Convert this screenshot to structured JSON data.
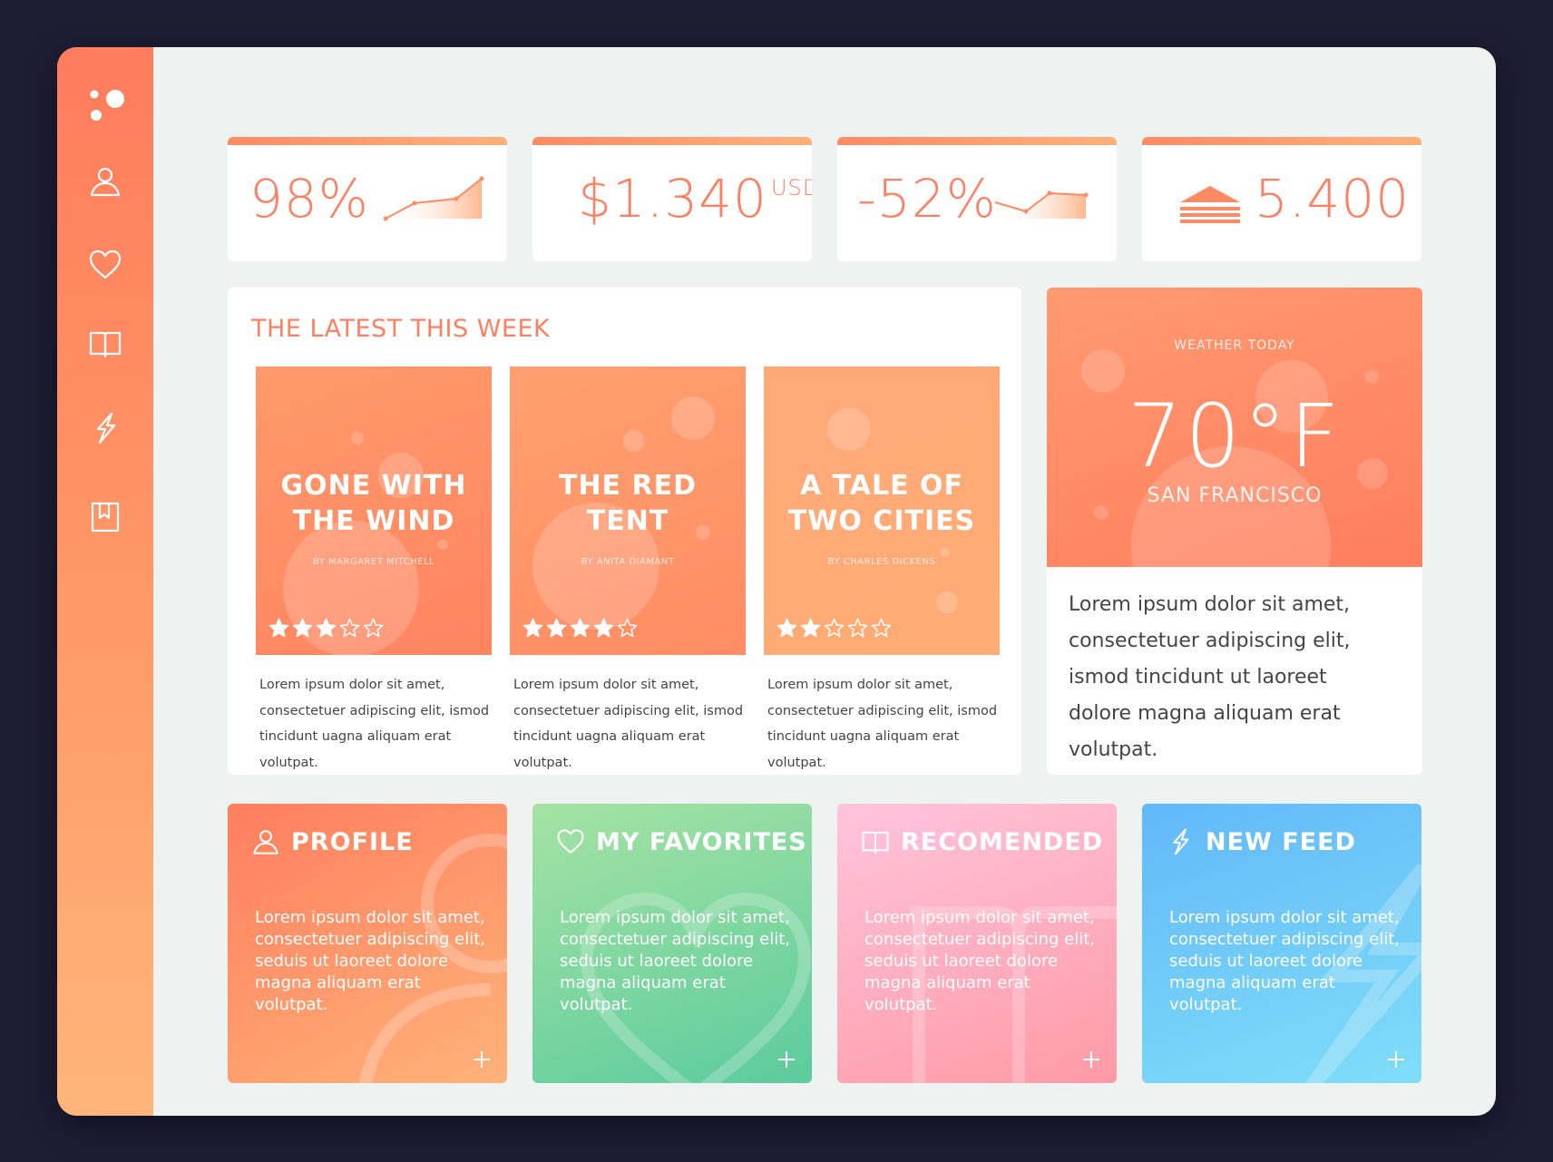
{
  "stats": [
    {
      "value": "98%",
      "unit": ""
    },
    {
      "value": "$1.340",
      "unit": "USD"
    },
    {
      "value": "-52%",
      "unit": ""
    },
    {
      "value": "5.400",
      "unit": ""
    }
  ],
  "latest": {
    "title": "THE LATEST THIS WEEK",
    "books": [
      {
        "title_line1": "GONE WITH",
        "title_line2": "THE WIND",
        "author": "BY MARGARET MITCHELL",
        "rating": 3,
        "rating_max": 5,
        "desc": "Lorem ipsum dolor sit amet, consectetuer adipiscing elit, ismod tincidunt uagna aliquam erat volutpat."
      },
      {
        "title_line1": "THE RED",
        "title_line2": "TENT",
        "author": "BY ANITA DIAMANT",
        "rating": 4,
        "rating_max": 5,
        "desc": "Lorem ipsum dolor sit amet, consectetuer adipiscing elit, ismod tincidunt uagna aliquam erat volutpat."
      },
      {
        "title_line1": "A TALE OF",
        "title_line2": "TWO CITIES",
        "author": "BY CHARLES DICKENS",
        "rating": 2,
        "rating_max": 5,
        "desc": "Lorem ipsum dolor sit amet, consectetuer adipiscing elit, ismod tincidunt uagna aliquam erat volutpat."
      }
    ]
  },
  "weather": {
    "label": "WEATHER TODAY",
    "temp": "70°F",
    "city": "SAN FRANCISCO",
    "desc": "Lorem ipsum dolor sit amet, consectetuer adipiscing elit, ismod tincidunt ut laoreet dolore magna aliquam erat volutpat."
  },
  "tiles": [
    {
      "title": "PROFILE",
      "icon": "user-icon",
      "text": "Lorem ipsum dolor sit amet, consectetuer adipiscing elit, seduis ut laoreet dolore magna aliquam erat volutpat."
    },
    {
      "title": "MY FAVORITES",
      "icon": "heart-icon",
      "text": "Lorem ipsum dolor sit amet, consectetuer adipiscing elit, seduis ut laoreet dolore magna aliquam erat volutpat."
    },
    {
      "title": "RECOMENDED",
      "icon": "book-icon",
      "text": "Lorem ipsum dolor sit amet, consectetuer adipiscing elit, seduis ut laoreet dolore magna aliquam erat volutpat."
    },
    {
      "title": "NEW FEED",
      "icon": "lightning-icon",
      "text": "Lorem ipsum dolor sit amet, consectetuer adipiscing elit, seduis ut laoreet dolore magna aliquam erat volutpat."
    }
  ],
  "sidebar": {
    "icons": [
      "logo-icon",
      "user-icon",
      "heart-icon",
      "book-icon",
      "lightning-icon",
      "bookmark-icon"
    ]
  },
  "colors": {
    "accent": "#ff7f63",
    "sidebar_top": "#ff7c5c",
    "sidebar_bottom": "#ffb57a",
    "tile_profile": "#ff8a62",
    "tile_favorites": "#7ed8a8",
    "tile_recommended": "#ffa4b4",
    "tile_newfeed": "#6ec8f8",
    "background": "#1e1d35"
  }
}
